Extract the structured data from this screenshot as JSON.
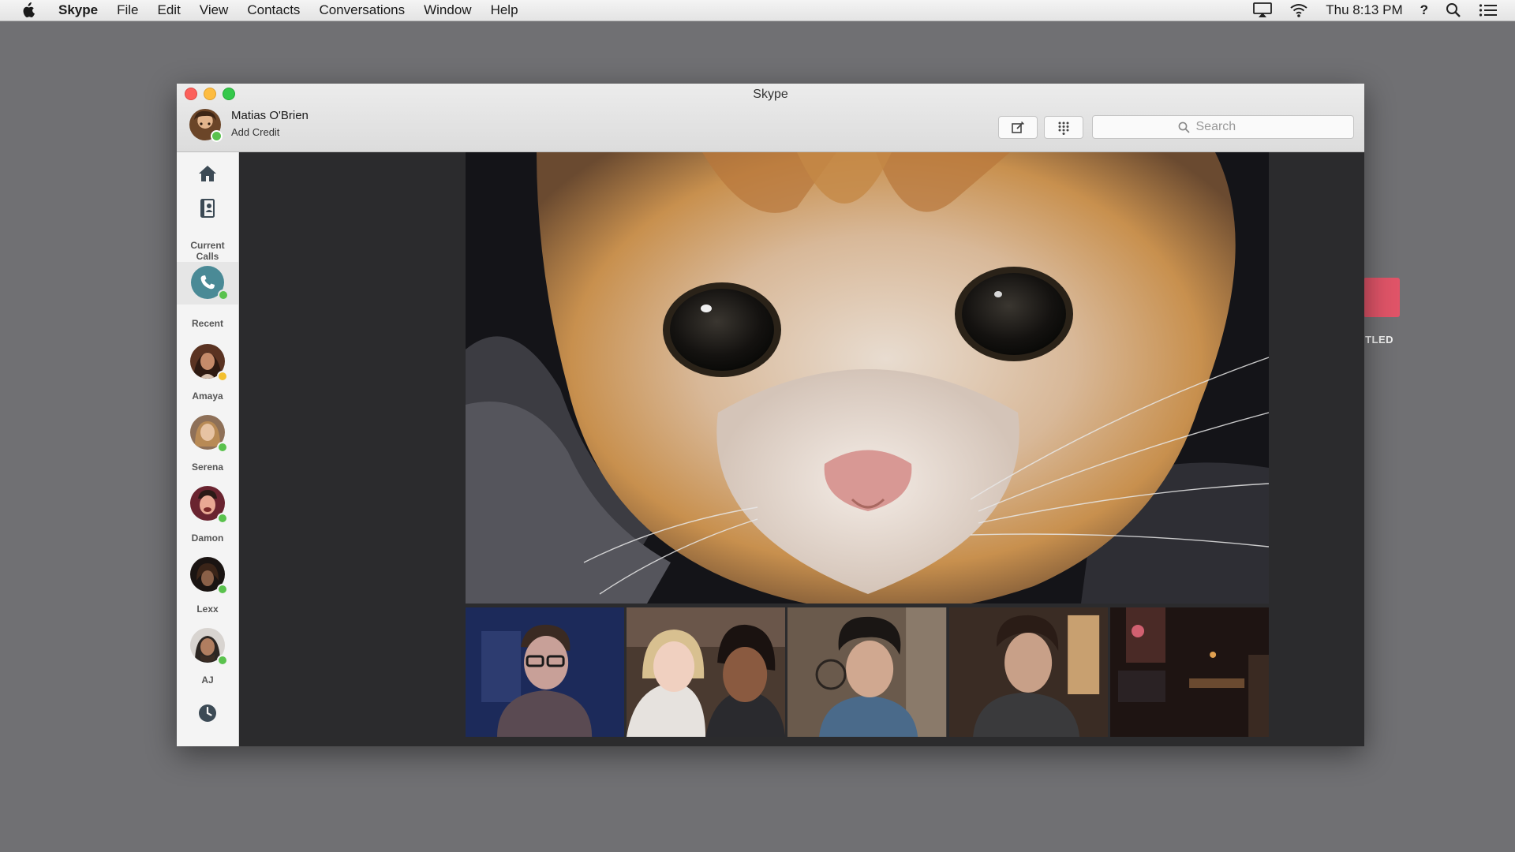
{
  "menubar": {
    "app_name": "Skype",
    "items": [
      "File",
      "Edit",
      "View",
      "Contacts",
      "Conversations",
      "Window",
      "Help"
    ],
    "clock": "Thu 8:13 PM",
    "help_glyph": "?"
  },
  "desktop": {
    "partial_label": "ITLED"
  },
  "window": {
    "title": "Skype",
    "profile": {
      "name": "Matias O'Brien",
      "subtitle": "Add Credit",
      "status": "online"
    },
    "search": {
      "placeholder": "Search"
    }
  },
  "sidebar": {
    "current_calls_label": "Current Calls",
    "recent_label": "Recent",
    "contacts": [
      {
        "name": "Amaya",
        "status": "away"
      },
      {
        "name": "Serena",
        "status": "online"
      },
      {
        "name": "Damon",
        "status": "online"
      },
      {
        "name": "Lexx",
        "status": "online"
      },
      {
        "name": "AJ",
        "status": "online"
      }
    ]
  },
  "call": {
    "main_video": "kitten-closeup",
    "participants": [
      "participant-1",
      "participant-2",
      "participant-3",
      "participant-4",
      "participant-5"
    ]
  },
  "colors": {
    "accent_call": "#4a8a96",
    "online": "#5ac24d",
    "away": "#f3c02f",
    "desktop_tile": "#e05468"
  }
}
